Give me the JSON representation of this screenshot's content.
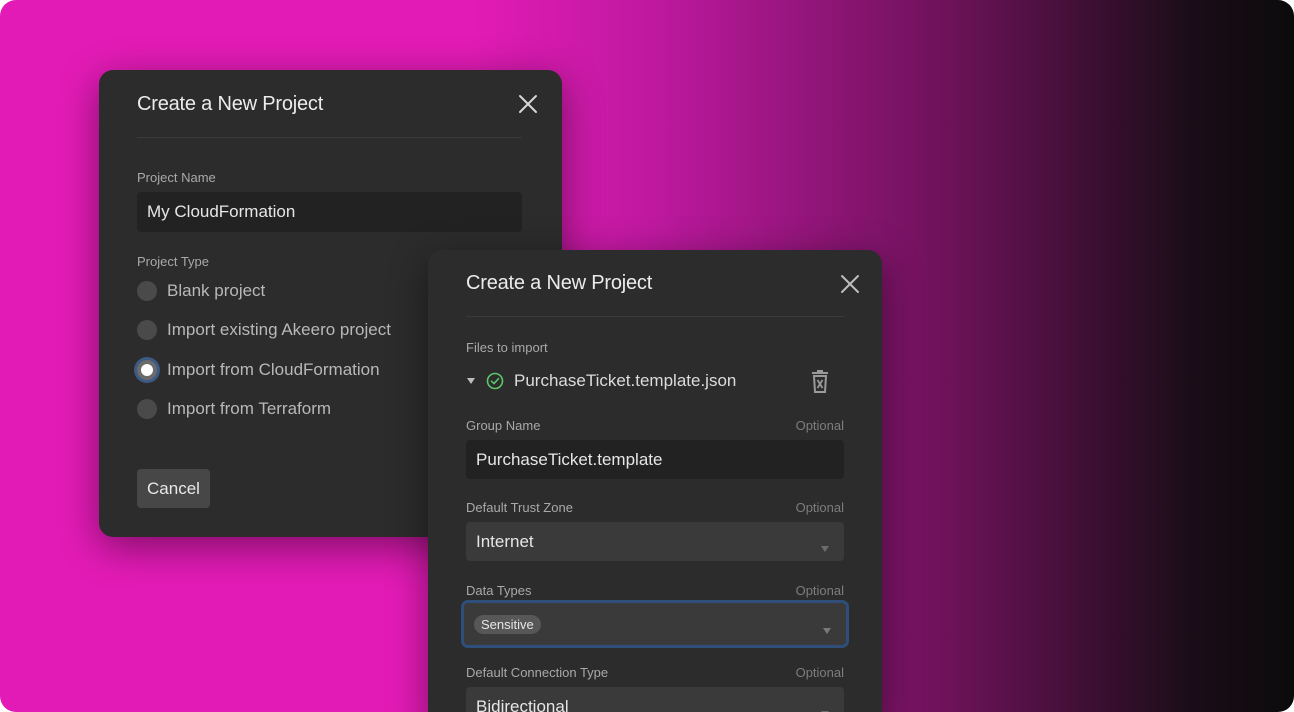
{
  "dialog1": {
    "title": "Create a New Project",
    "project_name_label": "Project Name",
    "project_name_value": "My CloudFormation",
    "project_type_label": "Project Type",
    "options": [
      {
        "label": "Blank project",
        "checked": false
      },
      {
        "label": "Import existing Akeero project",
        "checked": false
      },
      {
        "label": "Import from CloudFormation",
        "checked": true
      },
      {
        "label": "Import from Terraform",
        "checked": false
      }
    ],
    "cancel_label": "Cancel"
  },
  "dialog2": {
    "title": "Create a New Project",
    "files_label": "Files to import",
    "file_name": "PurchaseTicket.template.json",
    "group_name_label": "Group Name",
    "group_name_optional": "Optional",
    "group_name_value": "PurchaseTicket.template",
    "trust_zone_label": "Default Trust Zone",
    "trust_zone_optional": "Optional",
    "trust_zone_value": "Internet",
    "data_types_label": "Data Types",
    "data_types_optional": "Optional",
    "data_types_chip": "Sensitive",
    "connection_type_label": "Default Connection Type",
    "connection_type_optional": "Optional",
    "connection_type_value": "Bidirectional"
  },
  "colors": {
    "background_magenta": "#e31bb6",
    "background_dark": "#0b0b0b",
    "dialog_bg": "#2c2c2c",
    "focus_ring": "#3b5a86",
    "success_green": "#5cc86b"
  },
  "icons": {
    "close": "close-icon",
    "expand": "caret-down-icon",
    "success": "check-circle-icon",
    "delete": "trash-icon",
    "dropdown": "chevron-down-icon"
  }
}
